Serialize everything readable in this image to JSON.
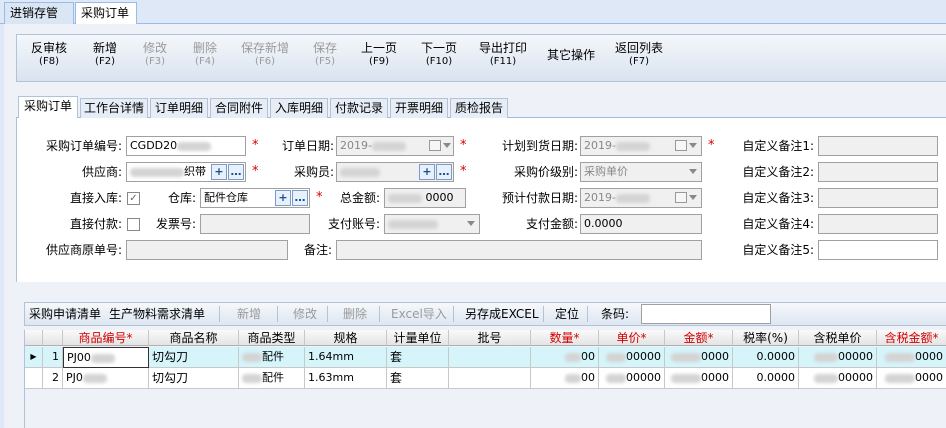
{
  "page_tabs": [
    {
      "label": "进销存管理"
    },
    {
      "label": "采购订单"
    }
  ],
  "toolbar": [
    {
      "label": "反审核",
      "key": "(F8)",
      "enabled": true
    },
    {
      "label": "新增",
      "key": "(F2)",
      "enabled": true
    },
    {
      "label": "修改",
      "key": "(F3)",
      "enabled": false
    },
    {
      "label": "删除",
      "key": "(F4)",
      "enabled": false
    },
    {
      "label": "保存新增",
      "key": "(F6)",
      "enabled": false
    },
    {
      "label": "保存",
      "key": "(F5)",
      "enabled": false
    },
    {
      "label": "上一页",
      "key": "(F9)",
      "enabled": true
    },
    {
      "label": "下一页",
      "key": "(F10)",
      "enabled": true
    },
    {
      "label": "导出打印",
      "key": "(F11)",
      "enabled": true
    },
    {
      "label": "其它操作",
      "key": "",
      "enabled": true
    },
    {
      "label": "返回列表",
      "key": "(F7)",
      "enabled": true
    }
  ],
  "form_tabs": [
    {
      "label": "采购订单"
    },
    {
      "label": "工作台详情"
    },
    {
      "label": "订单明细"
    },
    {
      "label": "合同附件"
    },
    {
      "label": "入库明细"
    },
    {
      "label": "付款记录"
    },
    {
      "label": "开票明细"
    },
    {
      "label": "质检报告"
    }
  ],
  "form": {
    "order_no_label": "采购订单编号:",
    "order_no": "CGDD20",
    "order_date_label": "订单日期:",
    "order_date": "2019-",
    "plan_date_label": "计划到货日期:",
    "plan_date": "2019-",
    "supplier_label": "供应商:",
    "supplier_suffix": "织带",
    "buyer_label": "采购员:",
    "price_level_label": "采购价级别:",
    "price_level": "采购单价",
    "direct_in_label": "直接入库:",
    "direct_in_mark": "✓",
    "warehouse_label": "仓库:",
    "warehouse": "配件仓库",
    "total_label": "总金额:",
    "total": "0000",
    "pay_date_label": "预计付款日期:",
    "pay_date": "2019-",
    "direct_pay_label": "直接付款:",
    "invoice_label": "发票号:",
    "pay_account_label": "支付账号:",
    "paid_label": "支付金额:",
    "paid": "0.0000",
    "supplier_no_label": "供应商原单号:",
    "remark_label": "备注:",
    "custom1": "自定义备注1:",
    "custom2": "自定义备注2:",
    "custom3": "自定义备注3:",
    "custom4": "自定义备注4:",
    "custom5": "自定义备注5:"
  },
  "grid_toolbar": {
    "items": [
      {
        "label": "采购申请清单",
        "enabled": true
      },
      {
        "label": "生产物料需求清单",
        "enabled": true
      },
      {
        "label": "新增",
        "enabled": false
      },
      {
        "label": "修改",
        "enabled": false
      },
      {
        "label": "删除",
        "enabled": false
      },
      {
        "label": "Excel导入",
        "enabled": false
      },
      {
        "label": "另存成EXCEL",
        "enabled": true
      },
      {
        "label": "定位",
        "enabled": true
      }
    ],
    "search_label": "条码:"
  },
  "grid": {
    "columns": [
      "商品编号*",
      "商品名称",
      "商品类型",
      "规格",
      "计量单位",
      "批号",
      "数量*",
      "单价*",
      "金额*",
      "税率(%)",
      "含税单价",
      "含税金额*"
    ],
    "rows": [
      {
        "no": "1",
        "code": "PJ00",
        "name": "切勾刀",
        "type": "配件",
        "spec": "1.64mm",
        "unit": "套",
        "batch": "",
        "qty": "00",
        "price": "00000",
        "amount": "0000",
        "tax": "0.0000",
        "tax_price": "00000",
        "tax_amount": "0000"
      },
      {
        "no": "2",
        "code": "PJ0",
        "name": "切勾刀",
        "type": "配件",
        "spec": "1.63mm",
        "unit": "套",
        "batch": "",
        "qty": "00",
        "price": "00000",
        "amount": "0000",
        "tax": "0.0000",
        "tax_price": "00000",
        "tax_amount": "0000"
      }
    ]
  }
}
